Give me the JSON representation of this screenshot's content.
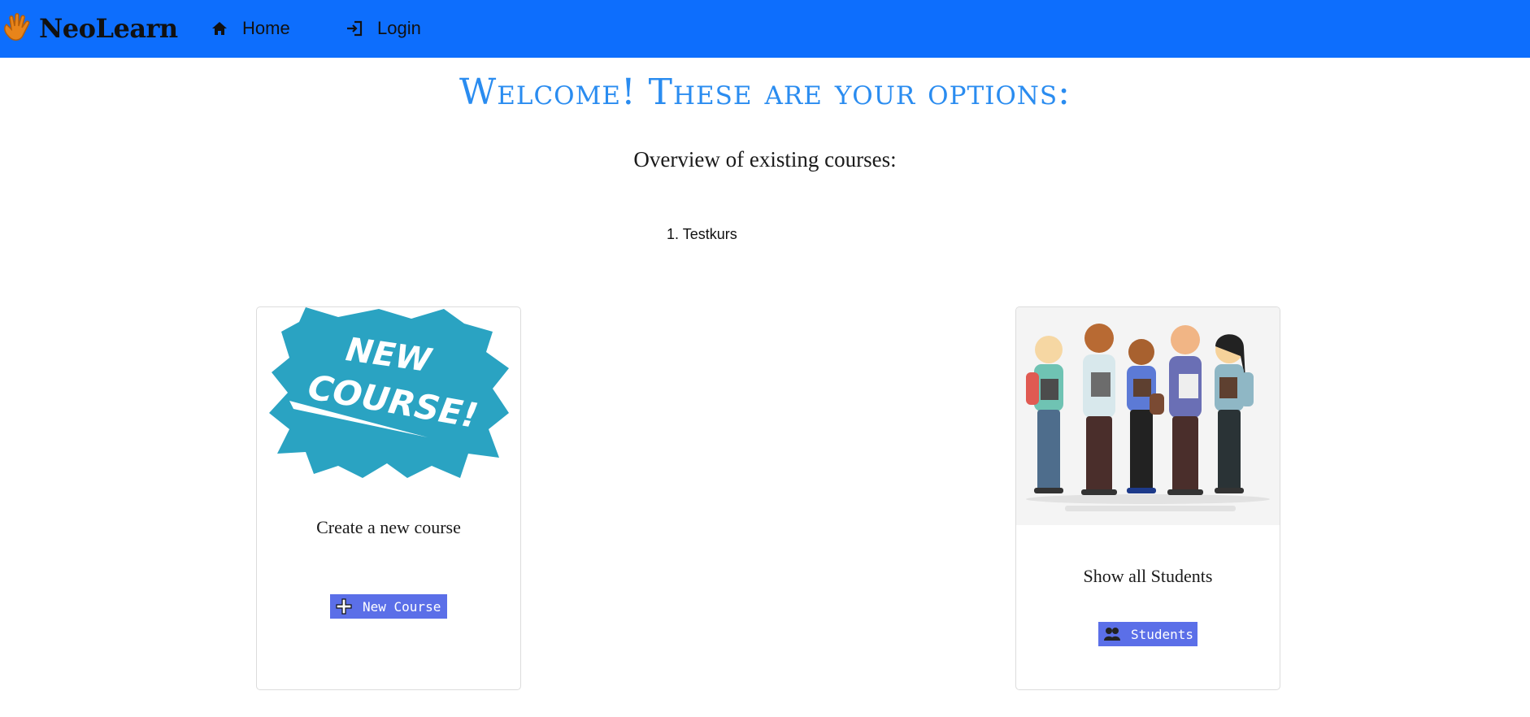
{
  "navbar": {
    "brand": "NeoLearn",
    "brand_icon": "hand-icon",
    "items": [
      {
        "label": "Home",
        "icon": "home-icon"
      },
      {
        "label": "Login",
        "icon": "login-icon"
      }
    ],
    "color": "#0d6efd"
  },
  "main": {
    "title": "Welcome! These are your options:",
    "subtitle": "Overview of existing courses:",
    "courses": [
      "Testkurs"
    ]
  },
  "cards": {
    "new_course": {
      "image_text_line1": "NEW",
      "image_text_line2": "COURSE!",
      "title": "Create a new course",
      "button_label": "New Course",
      "button_icon": "plus-icon"
    },
    "students": {
      "title": "Show all Students",
      "button_label": "Students",
      "button_icon": "users-icon"
    }
  },
  "colors": {
    "accent": "#2a8cf0",
    "button": "#5b6fe8",
    "splash": "#2aa3c2"
  }
}
